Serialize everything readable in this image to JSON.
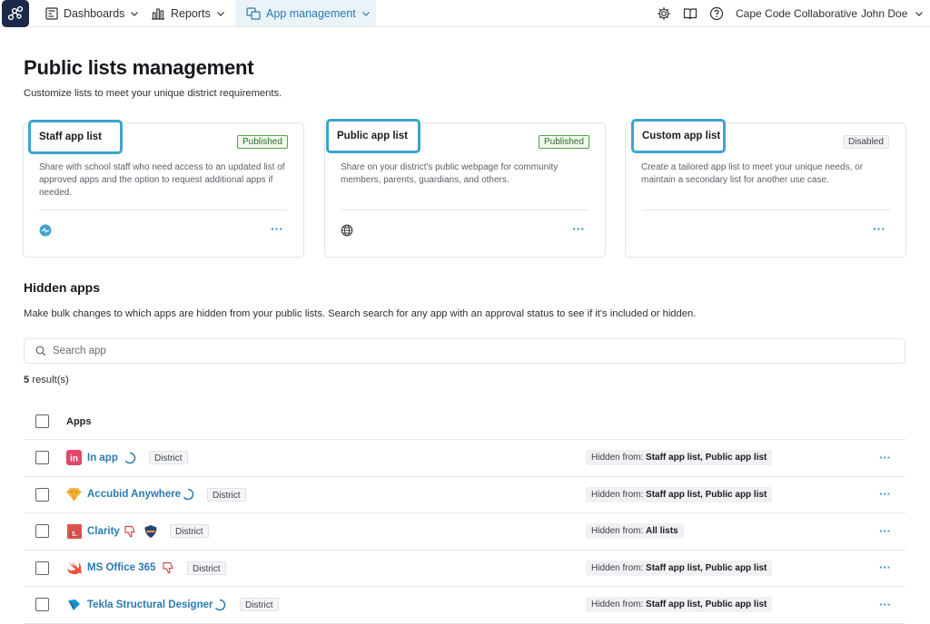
{
  "nav": {
    "dashboards": "Dashboards",
    "reports": "Reports",
    "app_management": "App management",
    "org": "Cape Code Collaborative",
    "user": "John Doe"
  },
  "page": {
    "title": "Public lists management",
    "subtitle": "Customize lists to meet your unique district requirements."
  },
  "cards": [
    {
      "title": "Staff app list",
      "status": "Published",
      "description": "Share with school staff who need access to an updated list of approved apps and the option to request additional apps if needed.",
      "more": "···"
    },
    {
      "title": "Public app list",
      "status": "Published",
      "description": "Share on your district's public webpage for community members, parents, guardians, and others.",
      "more": "···"
    },
    {
      "title": "Custom app list",
      "status": "Disabled",
      "description": "Create a tailored app list to meet your unique needs, or maintain a secondary list for another use case.",
      "more": "···"
    }
  ],
  "hidden": {
    "title": "Hidden apps",
    "description": "Make bulk changes to which apps are hidden from your public lists. Search search for any app with an approval status to see if it's included or hidden.",
    "search_placeholder": "Search app",
    "result_count": "5",
    "result_suffix": " result(s)",
    "column_apps": "Apps",
    "hidden_prefix": "Hidden from: ",
    "more": "···",
    "rows": [
      {
        "name": "In app",
        "tag": "District",
        "hidden_from": "Staff app list, Public app list",
        "icon": "invision-icon"
      },
      {
        "name": "Accubid Anywhere",
        "tag": "District",
        "hidden_from": "Staff app list, Public app list",
        "icon": "gem-icon"
      },
      {
        "name": "Clarity",
        "tag": "District",
        "hidden_from": "All lists",
        "icon": "clarity-icon"
      },
      {
        "name": "MS Office 365",
        "tag": "District",
        "hidden_from": "Staff app list, Public app list",
        "icon": "swift-icon"
      },
      {
        "name": "Tekla Structural Designer",
        "tag": "District",
        "hidden_from": "Staff app list, Public app list",
        "icon": "tekla-icon"
      }
    ]
  }
}
